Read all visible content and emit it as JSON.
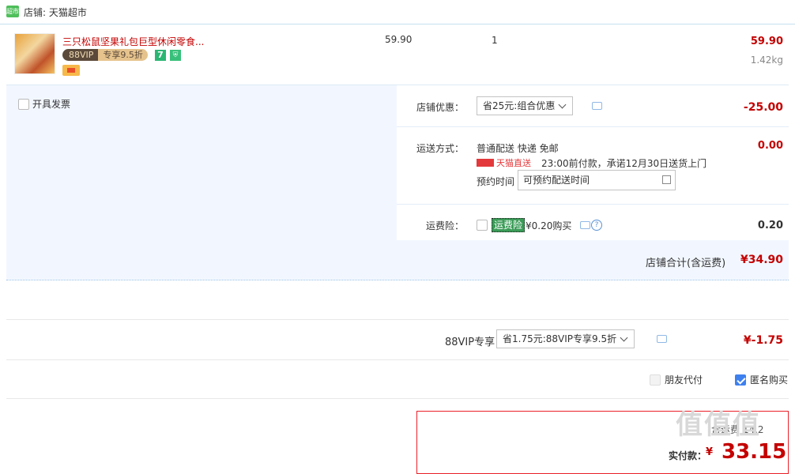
{
  "shop": {
    "icon_text": "超市",
    "label": "店铺: 天猫超市"
  },
  "item": {
    "title": "三只松鼠坚果礼包巨型休闲零食...",
    "vip_tag_a": "88VIP",
    "vip_tag_b": "专享9.5折",
    "tag_7": "7",
    "price": "59.90",
    "quantity": "1",
    "total": "59.90",
    "weight": "1.42kg"
  },
  "invoice": {
    "label": "开具发票"
  },
  "shop_discount": {
    "label": "店铺优惠：",
    "select_value": "省25元:组合优惠",
    "amount": "-25.00"
  },
  "shipping": {
    "label": "运送方式：",
    "method": "普通配送 快递 免邮",
    "amount": "0.00",
    "tmall_tag": "天猫直送",
    "promise": "23:00前付款，承诺12月30日送货上门",
    "book_label": "预约时间",
    "book_placeholder": "可预约配送时间"
  },
  "insurance": {
    "label": "运费险：",
    "tag": "运费险",
    "price_text": "¥0.20购买",
    "help": "?",
    "amount": "0.20"
  },
  "shop_total": {
    "label": "店铺合计(含运费)",
    "amount": "¥34.90"
  },
  "vip": {
    "label": "88VIP专享",
    "select_value": "省1.75元:88VIP专享9.5折",
    "amount": "¥-1.75"
  },
  "options": {
    "friend_pay": "朋友代付",
    "anonymous": "匿名购买"
  },
  "pay": {
    "partial_text": "含运费 14.2",
    "label": "实付款：",
    "amount": "33.15"
  },
  "watermark": "值值值"
}
